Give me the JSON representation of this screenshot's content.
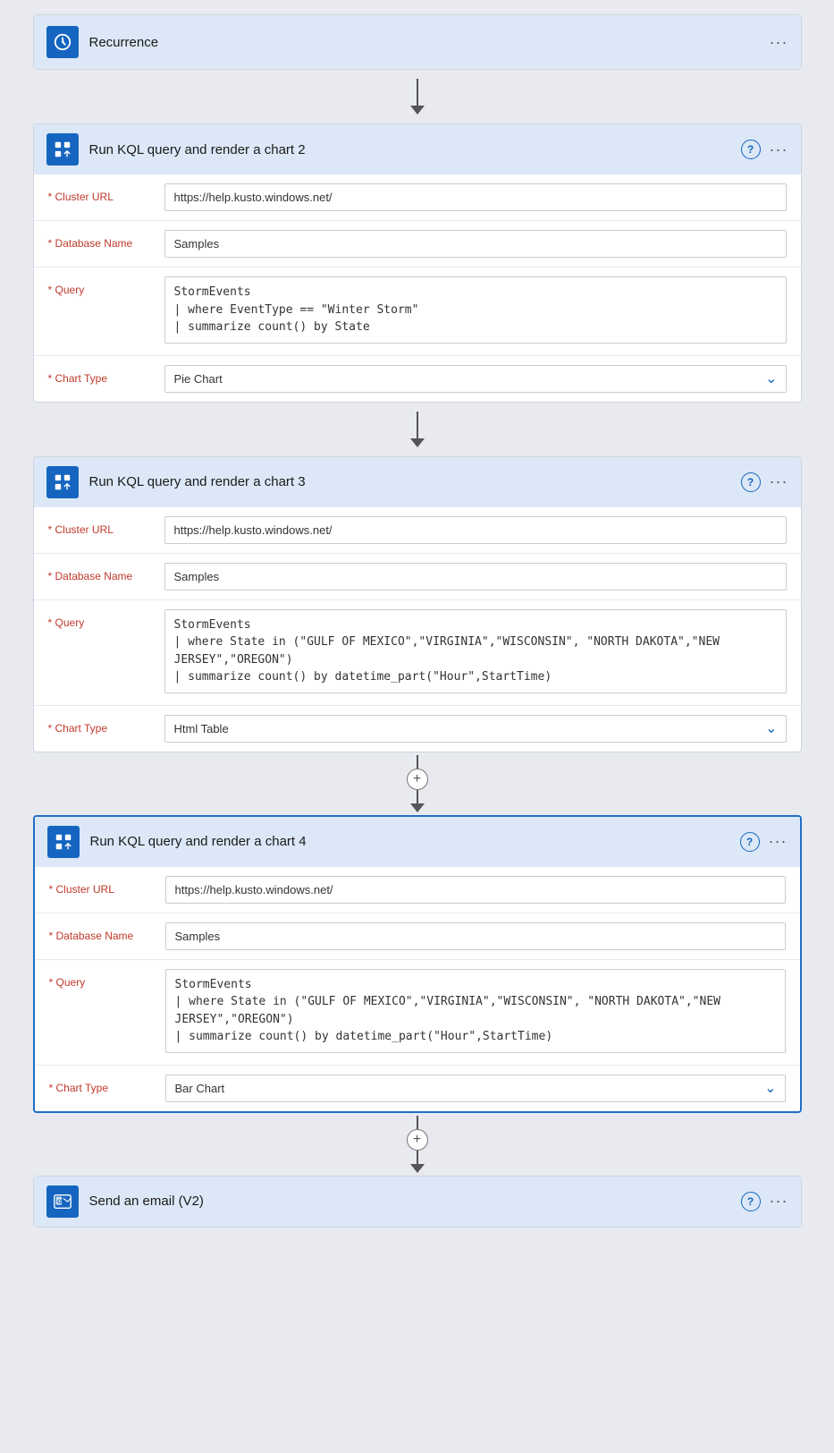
{
  "recurrence": {
    "title": "Recurrence",
    "icon": "clock-icon"
  },
  "cards": [
    {
      "id": "card2",
      "title": "Run KQL query and render a chart 2",
      "active": false,
      "fields": [
        {
          "label": "Cluster URL",
          "type": "input",
          "value": "https://help.kusto.windows.net/"
        },
        {
          "label": "Database Name",
          "type": "input",
          "value": "Samples"
        },
        {
          "label": "Query",
          "type": "textarea",
          "value": "StormEvents\n| where EventType == \"Winter Storm\"\n| summarize count() by State"
        },
        {
          "label": "Chart Type",
          "type": "select",
          "value": "Pie Chart"
        }
      ]
    },
    {
      "id": "card3",
      "title": "Run KQL query and render a chart 3",
      "active": false,
      "fields": [
        {
          "label": "Cluster URL",
          "type": "input",
          "value": "https://help.kusto.windows.net/"
        },
        {
          "label": "Database Name",
          "type": "input",
          "value": "Samples"
        },
        {
          "label": "Query",
          "type": "textarea",
          "value": "StormEvents\n| where State in (\"GULF OF MEXICO\",\"VIRGINIA\",\"WISCONSIN\", \"NORTH DAKOTA\",\"NEW JERSEY\",\"OREGON\")\n| summarize count() by datetime_part(\"Hour\",StartTime)"
        },
        {
          "label": "Chart Type",
          "type": "select",
          "value": "Html Table"
        }
      ]
    },
    {
      "id": "card4",
      "title": "Run KQL query and render a chart 4",
      "active": true,
      "fields": [
        {
          "label": "Cluster URL",
          "type": "input",
          "value": "https://help.kusto.windows.net/"
        },
        {
          "label": "Database Name",
          "type": "input",
          "value": "Samples"
        },
        {
          "label": "Query",
          "type": "textarea",
          "value": "StormEvents\n| where State in (\"GULF OF MEXICO\",\"VIRGINIA\",\"WISCONSIN\", \"NORTH DAKOTA\",\"NEW JERSEY\",\"OREGON\")\n| summarize count() by datetime_part(\"Hour\",StartTime)"
        },
        {
          "label": "Chart Type",
          "type": "select",
          "value": "Bar Chart"
        }
      ]
    }
  ],
  "emailCard": {
    "title": "Send an email (V2)",
    "icon": "email-icon"
  },
  "buttons": {
    "help": "?",
    "more": "···",
    "plus": "+"
  }
}
